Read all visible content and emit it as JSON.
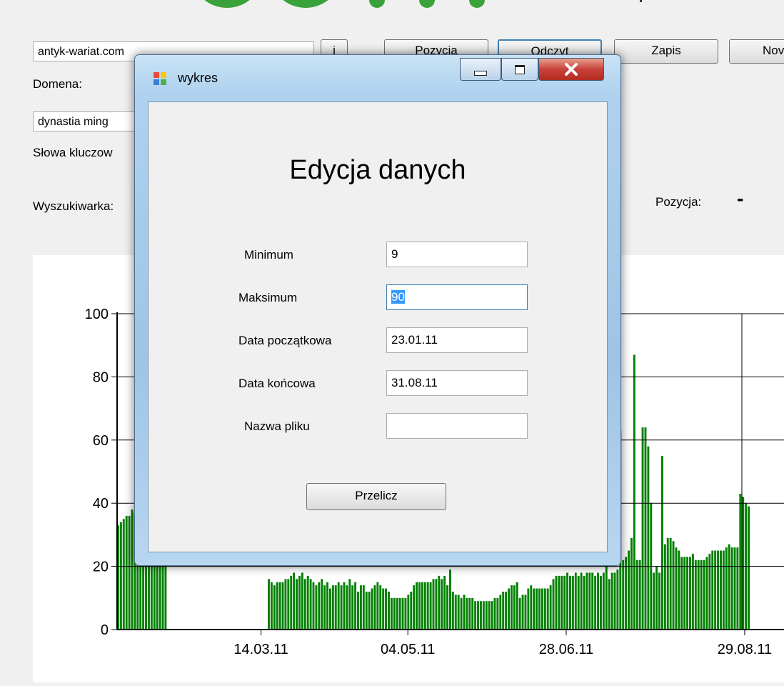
{
  "main": {
    "domain_value": "antyk-wariat.com",
    "domain_label": "Domena:",
    "keyword_value": "dynastia ming",
    "keyword_label": "Słowa kluczow",
    "engine_label": "Wyszukiwarka:",
    "position_label": "Pozycja:",
    "position_value": "-",
    "buttons": {
      "info": "i",
      "position": "Pozycja",
      "read": "Odczyt",
      "save": "Zapis",
      "new": "Nov"
    }
  },
  "dialog": {
    "title": "wykres",
    "heading": "Edycja danych",
    "fields": {
      "min_label": "Minimum",
      "min_value": "9",
      "max_label": "Maksimum",
      "max_value": "90",
      "start_label": "Data początkowa",
      "start_value": "23.01.11",
      "end_label": "Data końcowa",
      "end_value": "31.08.11",
      "file_label": "Nazwa pliku",
      "file_value": ""
    },
    "recalc_button": "Przelicz"
  },
  "colors": {
    "bar": "#008000",
    "window_close": "#c9413a",
    "selection": "#3399ff"
  },
  "chart_data": {
    "type": "bar",
    "ylim": [
      0,
      100
    ],
    "yticks": [
      "0",
      "20",
      "40",
      "60",
      "80",
      "100"
    ],
    "xticks": [
      "14.03.11",
      "04.05.11",
      "28.06.11",
      "29.08.11"
    ],
    "x_range": [
      "23.01.11",
      "31.08.11"
    ],
    "series": [
      {
        "values": [
          33,
          34,
          35,
          36,
          36,
          38,
          37,
          34,
          35,
          36,
          34,
          38,
          36,
          37,
          35,
          36,
          33,
          38,
          0,
          0,
          0,
          0,
          0,
          0,
          0,
          0,
          0,
          0,
          0,
          0,
          0,
          0,
          0,
          0,
          0,
          0,
          0,
          0,
          0,
          0,
          0,
          0,
          0,
          0,
          0,
          0,
          0,
          0,
          0,
          0,
          0,
          0,
          0,
          0,
          16,
          15,
          14,
          15,
          15,
          15,
          16,
          16,
          17,
          18,
          16,
          17,
          18,
          16,
          17,
          16,
          15,
          14,
          15,
          16,
          14,
          15,
          13,
          14,
          14,
          15,
          14,
          15,
          14,
          16,
          14,
          15,
          12,
          14,
          14,
          12,
          12,
          13,
          14,
          15,
          14,
          13,
          13,
          12,
          10,
          10,
          10,
          10,
          10,
          10,
          11,
          12,
          14,
          15,
          15,
          15,
          15,
          15,
          15,
          16,
          16,
          17,
          16,
          17,
          14,
          19,
          12,
          11,
          11,
          10,
          11,
          10,
          10,
          10,
          9,
          9,
          9,
          9,
          9,
          9,
          9,
          10,
          10,
          11,
          12,
          12,
          13,
          14,
          14,
          15,
          10,
          11,
          11,
          13,
          14,
          13,
          13,
          13,
          13,
          13,
          13,
          14,
          16,
          17,
          17,
          17,
          17,
          18,
          17,
          17,
          18,
          17,
          18,
          17,
          18,
          18,
          18,
          17,
          18,
          17,
          18,
          22,
          16,
          18,
          18,
          19,
          63,
          22,
          23,
          25,
          29,
          87,
          22,
          22,
          64,
          64,
          58,
          40,
          18,
          20,
          18,
          55,
          27,
          29,
          29,
          28,
          26,
          25,
          23,
          23,
          23,
          23,
          24,
          22,
          22,
          22,
          22,
          23,
          24,
          25,
          25,
          25,
          25,
          25,
          26,
          27,
          26,
          26,
          26,
          43,
          42,
          40,
          39
        ]
      }
    ]
  }
}
